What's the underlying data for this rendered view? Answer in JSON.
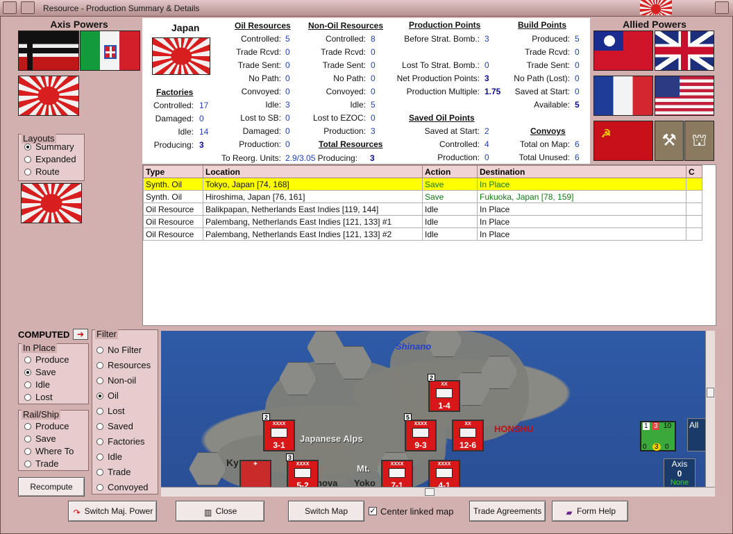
{
  "window": {
    "title": "Resource - Production Summary & Details"
  },
  "axis": {
    "title": "Axis Powers"
  },
  "allied": {
    "title": "Allied Powers"
  },
  "layouts": {
    "legend": "Layouts",
    "options": [
      "Summary",
      "Expanded",
      "Route"
    ],
    "selected": "Summary"
  },
  "country": {
    "name": "Japan"
  },
  "factories": {
    "heading": "Factories",
    "rows": [
      {
        "label": "Controlled:",
        "value": "17"
      },
      {
        "label": "Damaged:",
        "value": "0"
      },
      {
        "label": "Idle:",
        "value": "14"
      },
      {
        "label": "Producing:",
        "value": "3"
      }
    ]
  },
  "oil": {
    "heading": "Oil Resources",
    "rows": [
      {
        "label": "Controlled:",
        "value": "5"
      },
      {
        "label": "Trade Rcvd:",
        "value": "0"
      },
      {
        "label": "Trade Sent:",
        "value": "0"
      },
      {
        "label": "No Path:",
        "value": "0"
      },
      {
        "label": "Convoyed:",
        "value": "0"
      },
      {
        "label": "Idle:",
        "value": "3"
      },
      {
        "label": "Lost to SB:",
        "value": "0"
      },
      {
        "label": "Damaged:",
        "value": "0"
      },
      {
        "label": "Production:",
        "value": "0"
      }
    ],
    "reorg_label": "To Reorg. Units:",
    "reorg_value": "2.9/3.05"
  },
  "nonoil": {
    "heading": "Non-Oil Resources",
    "rows": [
      {
        "label": "Controlled:",
        "value": "8"
      },
      {
        "label": "Trade Rcvd:",
        "value": "0"
      },
      {
        "label": "Trade Sent:",
        "value": "0"
      },
      {
        "label": "No Path:",
        "value": "0"
      },
      {
        "label": "Convoyed:",
        "value": "0"
      },
      {
        "label": "Idle:",
        "value": "5"
      },
      {
        "label": "Lost to EZOC:",
        "value": "0"
      },
      {
        "label": "Production:",
        "value": "3"
      }
    ]
  },
  "total": {
    "heading": "Total Resources",
    "label": "Producing:",
    "value": "3"
  },
  "production": {
    "heading": "Production Points",
    "rows": [
      {
        "label": "Before Strat. Bomb.:",
        "value": "3"
      },
      {
        "label": "Lost To Strat. Bomb.:",
        "value": "0"
      },
      {
        "label": "Net Production Points:",
        "value": "3"
      },
      {
        "label": "Production Multiple:",
        "value": "1.75"
      }
    ]
  },
  "saved_oil": {
    "heading": "Saved Oil Points",
    "rows": [
      {
        "label": "Saved at Start:",
        "value": "2"
      },
      {
        "label": "Controlled:",
        "value": "4"
      },
      {
        "label": "Production:",
        "value": "0"
      }
    ]
  },
  "build": {
    "heading": "Build Points",
    "rows": [
      {
        "label": "Produced:",
        "value": "5"
      },
      {
        "label": "Trade Rcvd:",
        "value": "0"
      },
      {
        "label": "Trade Sent:",
        "value": "0"
      },
      {
        "label": "No Path (Lost):",
        "value": "0"
      },
      {
        "label": "Saved at Start:",
        "value": "0"
      },
      {
        "label": "Available:",
        "value": "5"
      }
    ]
  },
  "convoys": {
    "heading": "Convoys",
    "rows": [
      {
        "label": "Total on Map:",
        "value": "6"
      },
      {
        "label": "Total Unused:",
        "value": "6"
      }
    ]
  },
  "table": {
    "headers": [
      "Type",
      "Location",
      "Action",
      "Destination",
      "C"
    ],
    "rows": [
      {
        "type": "Synth. Oil",
        "location": "Tokyo, Japan [74, 168]",
        "action": "Save",
        "destination": "In Place"
      },
      {
        "type": "Synth. Oil",
        "location": "Hiroshima, Japan [76, 161]",
        "action": "Save",
        "destination": "Fukuoka, Japan [78, 159]"
      },
      {
        "type": "Oil Resource",
        "location": "Balikpapan, Netherlands East Indies [119, 144]",
        "action": "Idle",
        "destination": "In Place"
      },
      {
        "type": "Oil Resource",
        "location": "Palembang, Netherlands East Indies [121, 133] #1",
        "action": "Idle",
        "destination": "In Place"
      },
      {
        "type": "Oil Resource",
        "location": "Palembang, Netherlands East Indies [121, 133] #2",
        "action": "Idle",
        "destination": "In Place"
      }
    ]
  },
  "computed": {
    "label": "COMPUTED"
  },
  "in_place": {
    "legend": "In Place",
    "options": [
      "Produce",
      "Save",
      "Idle",
      "Lost"
    ],
    "selected": "Save"
  },
  "rail_ship": {
    "legend": "Rail/Ship",
    "options": [
      "Produce",
      "Save",
      "Where To",
      "Trade"
    ]
  },
  "filter": {
    "legend": "Filter",
    "options": [
      "No Filter",
      "Resources",
      "Non-oil",
      "Oil",
      "Lost",
      "Saved",
      "Factories",
      "Idle",
      "Trade",
      "Convoyed"
    ],
    "selected": "Oil"
  },
  "map": {
    "labels": {
      "shinano": "Shinano",
      "honshu": "HONSHU",
      "alps": "Japanese Alps",
      "ky": "Ky",
      "mt": "Mt.",
      "yoko": "Yoko",
      "nova": "nova"
    },
    "units": [
      {
        "badge": "2",
        "value": "1-4"
      },
      {
        "badge": "2",
        "value": "3-1"
      },
      {
        "badge": "5",
        "value": "9-3"
      },
      {
        "badge": "",
        "value": "12-6"
      },
      {
        "badge": "3",
        "value": "5-2"
      },
      {
        "badge": "",
        "value": "7-1"
      },
      {
        "badge": "",
        "value": "4-1"
      }
    ],
    "side_box": {
      "title": "Axis",
      "value": "0",
      "sub": "None"
    },
    "air_unit": {
      "a": "1",
      "b": "3",
      "c": "10",
      "d": "0",
      "e": "3",
      "f": "0"
    },
    "edge_text": "All"
  },
  "buttons": {
    "recompute": "Recompute",
    "switch_power": "Switch Maj. Power",
    "close": "Close",
    "switch_map": "Switch Map",
    "center_linked": "Center linked map",
    "trade": "Trade Agreements",
    "form_help": "Form Help"
  }
}
